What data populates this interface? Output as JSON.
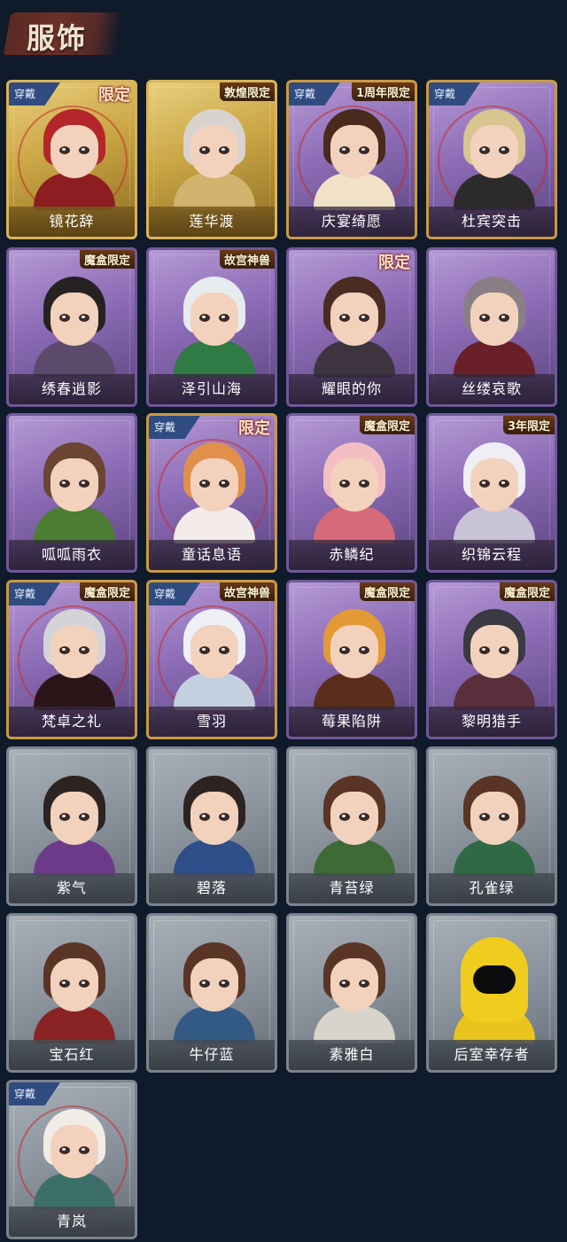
{
  "page": {
    "title": "服饰"
  },
  "costumes": [
    {
      "name": "镜花辞",
      "tag": "限定",
      "equipped": true,
      "frame": "gold",
      "hair": "#b4262a",
      "outfit": "#8e1d22"
    },
    {
      "name": "莲华渡",
      "tag": "敦煌限定",
      "equipped": false,
      "frame": "gold",
      "hair": "#d8d3cf",
      "outfit": "#d2b36e"
    },
    {
      "name": "庆宴绮愿",
      "tag": "1周年限定",
      "equipped": true,
      "frame": "purple",
      "hair": "#4a2a1c",
      "outfit": "#f1e2c6"
    },
    {
      "name": "杜宾突击",
      "tag": "",
      "equipped": true,
      "frame": "purple",
      "hair": "#d8c58f",
      "outfit": "#2d2a2c"
    },
    {
      "name": "绣春逍影",
      "tag": "魔盒限定",
      "equipped": false,
      "frame": "purple",
      "hair": "#272222",
      "outfit": "#5c4a6a"
    },
    {
      "name": "泽引山海",
      "tag": "故宫神兽",
      "equipped": false,
      "frame": "purple",
      "hair": "#e6ecee",
      "outfit": "#2f7a45"
    },
    {
      "name": "耀眼的你",
      "tag": "限定",
      "equipped": false,
      "frame": "purple",
      "hair": "#4a2c22",
      "outfit": "#3d3440"
    },
    {
      "name": "丝缕哀歌",
      "tag": "",
      "equipped": false,
      "frame": "purple",
      "hair": "#8a7e86",
      "outfit": "#6a2028"
    },
    {
      "name": "呱呱雨衣",
      "tag": "",
      "equipped": false,
      "frame": "purple",
      "hair": "#6b4532",
      "outfit": "#4d7d32"
    },
    {
      "name": "童话息语",
      "tag": "限定",
      "equipped": true,
      "frame": "purple",
      "hair": "#e0904a",
      "outfit": "#f4ecea"
    },
    {
      "name": "赤鳞纪",
      "tag": "魔盒限定",
      "equipped": false,
      "frame": "purple",
      "hair": "#f3bfc2",
      "outfit": "#d56a7a"
    },
    {
      "name": "织锦云程",
      "tag": "3年限定",
      "equipped": false,
      "frame": "purple",
      "hair": "#efeef4",
      "outfit": "#c9c3d8"
    },
    {
      "name": "梵卓之礼",
      "tag": "魔盒限定",
      "equipped": true,
      "frame": "purple",
      "hair": "#d4d4d8",
      "outfit": "#2a1618"
    },
    {
      "name": "雪羽",
      "tag": "故宫神兽",
      "equipped": true,
      "frame": "purple",
      "hair": "#eef0f6",
      "outfit": "#c4cfe0"
    },
    {
      "name": "莓果陷阱",
      "tag": "魔盒限定",
      "equipped": false,
      "frame": "purple",
      "hair": "#e39a36",
      "outfit": "#5a2e1a"
    },
    {
      "name": "黎明猎手",
      "tag": "魔盒限定",
      "equipped": false,
      "frame": "purple",
      "hair": "#3a3a42",
      "outfit": "#5a2e3a"
    },
    {
      "name": "紫气",
      "tag": "",
      "equipped": false,
      "frame": "gray",
      "hair": "#2d2422",
      "outfit": "#6d3a8a"
    },
    {
      "name": "碧落",
      "tag": "",
      "equipped": false,
      "frame": "gray",
      "hair": "#2d2422",
      "outfit": "#2f4f8a"
    },
    {
      "name": "青苔绿",
      "tag": "",
      "equipped": false,
      "frame": "gray",
      "hair": "#5a3526",
      "outfit": "#3e6a36"
    },
    {
      "name": "孔雀绿",
      "tag": "",
      "equipped": false,
      "frame": "gray",
      "hair": "#5a3526",
      "outfit": "#2f6a44"
    },
    {
      "name": "宝石红",
      "tag": "",
      "equipped": false,
      "frame": "gray",
      "hair": "#5a3526",
      "outfit": "#8a2424"
    },
    {
      "name": "牛仔蓝",
      "tag": "",
      "equipped": false,
      "frame": "gray",
      "hair": "#5a3526",
      "outfit": "#335a84"
    },
    {
      "name": "素雅白",
      "tag": "",
      "equipped": false,
      "frame": "gray",
      "hair": "#5a3526",
      "outfit": "#d8d4cc"
    },
    {
      "name": "后室幸存者",
      "tag": "",
      "equipped": false,
      "frame": "gray",
      "hair": "#f0cc1e",
      "outfit": "#e8c41c",
      "mask": true
    },
    {
      "name": "青岚",
      "tag": "",
      "equipped": true,
      "frame": "gray",
      "hair": "#f1ece6",
      "outfit": "#3d6f6a"
    }
  ],
  "labels": {
    "equipped": "穿戴"
  }
}
